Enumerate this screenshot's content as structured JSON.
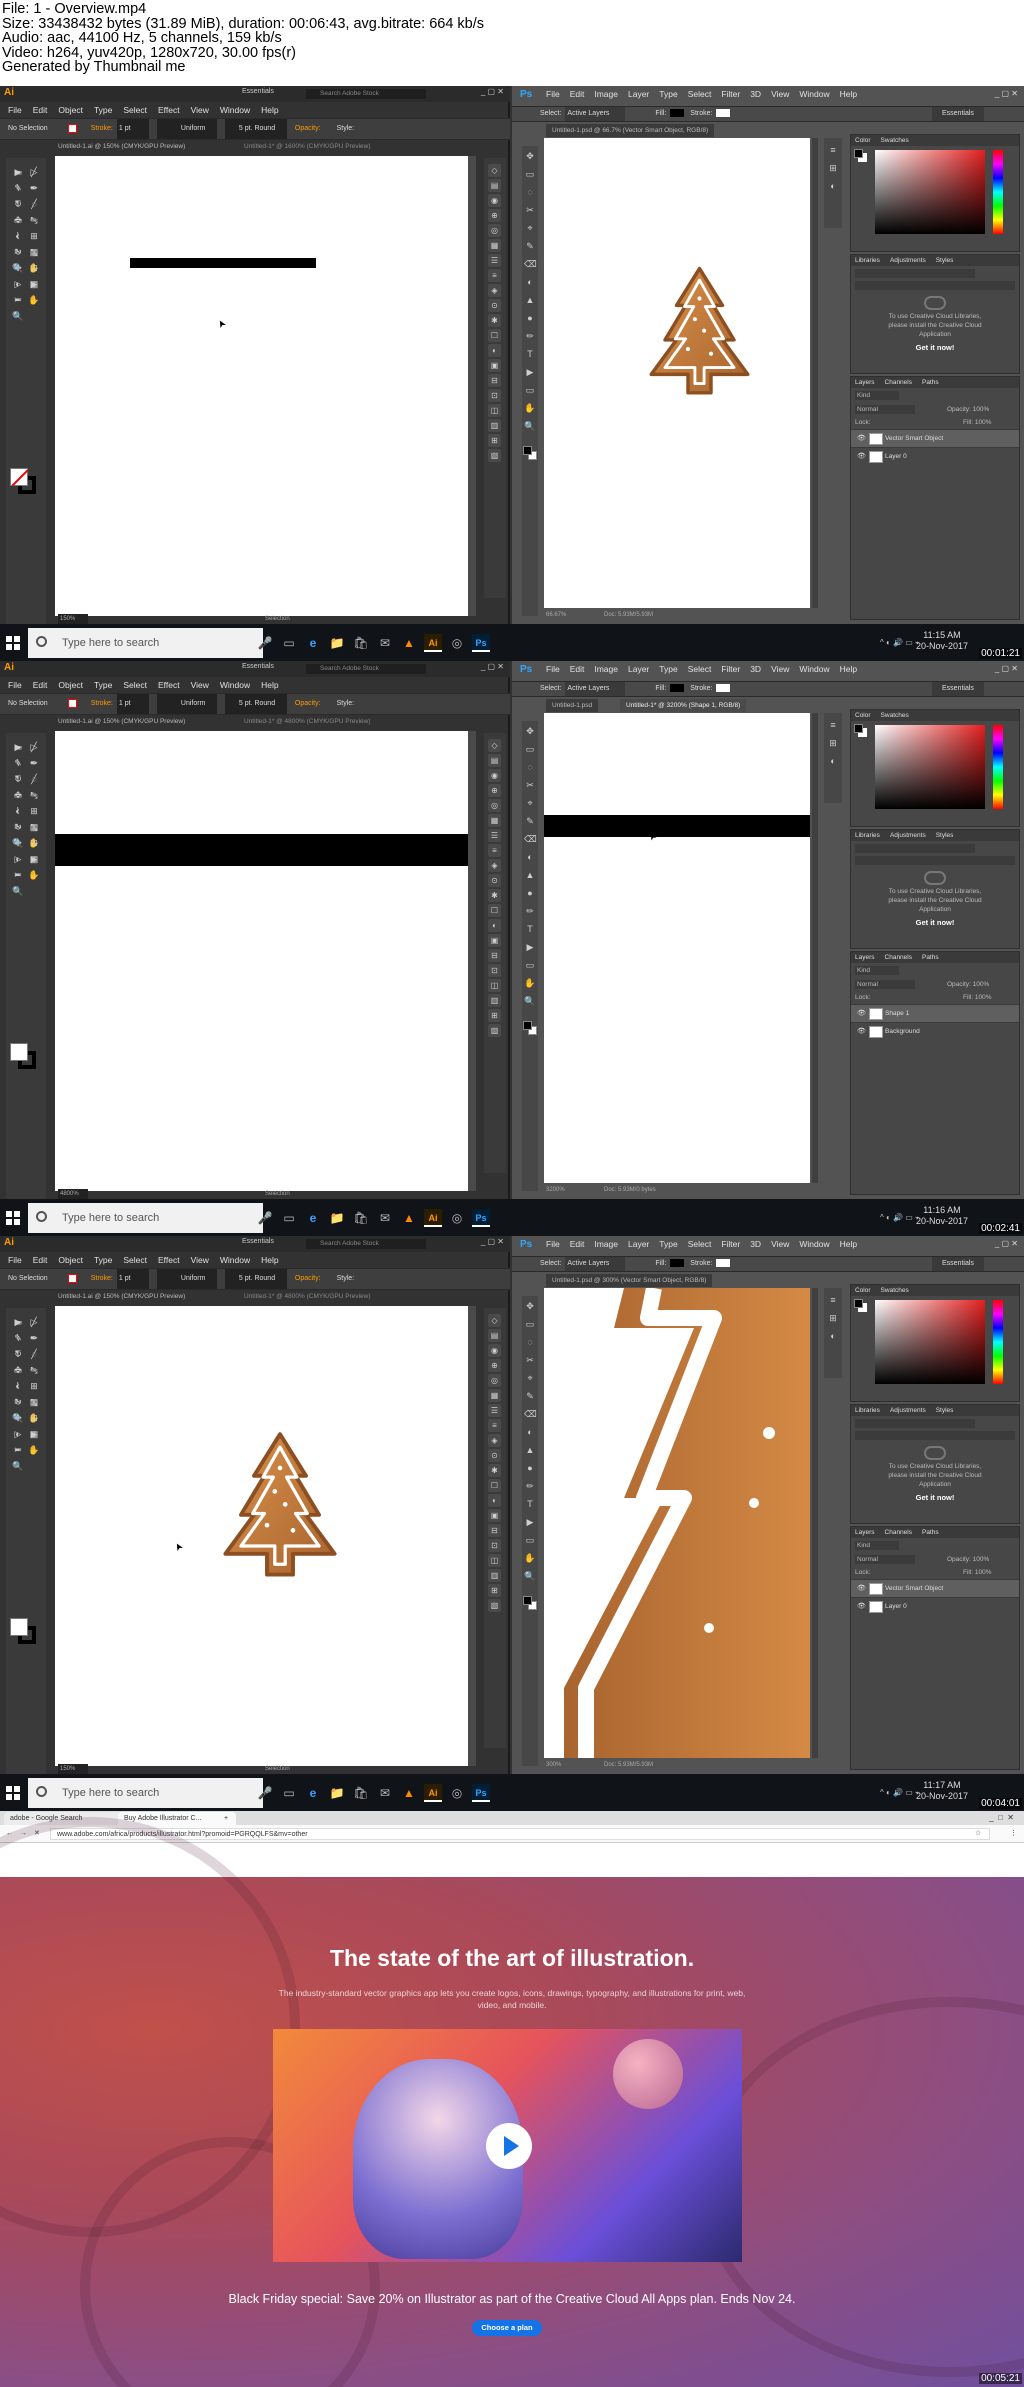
{
  "header": {
    "lines": [
      "File: 1 - Overview.mp4",
      "Size: 33438432 bytes (31.89 MiB), duration: 00:06:43, avg.bitrate: 664 kb/s",
      "Audio: aac, 44100 Hz, 5 channels, 159 kb/s",
      "Video: h264, yuv420p, 1280x720, 30.00 fps(r)",
      "Generated by Thumbnail me"
    ]
  },
  "illustrator": {
    "logo": "Ai",
    "workspace": "Essentials",
    "search_placeholder": "Search Adobe Stock",
    "menu": [
      "File",
      "Edit",
      "Object",
      "Type",
      "Select",
      "Effect",
      "View",
      "Window",
      "Help"
    ],
    "options": {
      "selection": "No Selection",
      "stroke_label": "Stroke:",
      "stroke_weight": "1 pt",
      "uniform": "Uniform",
      "brush": "5 pt. Round",
      "opacity_label": "Opacity:",
      "style_label": "Style:"
    },
    "status_label": "Selection"
  },
  "photoshop": {
    "logo": "Ps",
    "menu": [
      "File",
      "Edit",
      "Image",
      "Layer",
      "Type",
      "Select",
      "Filter",
      "3D",
      "View",
      "Window",
      "Help"
    ],
    "options": {
      "select_label": "Select:",
      "select_value": "Active Layers",
      "fill_label": "Fill:",
      "stroke_label": "Stroke:"
    },
    "workspace": "Essentials",
    "panels": {
      "color_tabs": [
        "Color",
        "Swatches"
      ],
      "libraries_tabs": [
        "Libraries",
        "Adjustments",
        "Styles"
      ],
      "libraries_message": "To use Creative Cloud Libraries, please install the Creative Cloud Application",
      "get_it_now": "Get it now!",
      "layers_tabs": [
        "Layers",
        "Channels",
        "Paths"
      ],
      "kind": "Kind",
      "blend": "Normal",
      "opacity": "Opacity: 100%",
      "lock": "Lock:",
      "fill": "Fill: 100%"
    }
  },
  "frames": [
    {
      "ai_tab": "Untitled-1.ai @ 150% (CMYK/GPU Preview)",
      "ai_tab2": "Untitled-1* @ 1600% (CMYK/GPU Preview)",
      "ai_zoom": "150%",
      "ps_tab": "Untitled-1.psd @ 66.7% (Vector Smart Object, RGB/8)",
      "ps_tab2": "",
      "ps_zoom": "66.67%",
      "ps_doc": "Doc: 5.93M/5.93M",
      "layers": [
        {
          "name": "Vector Smart Object",
          "selected": true
        },
        {
          "name": "Layer 0",
          "selected": false
        }
      ],
      "time": "11:15 AM",
      "date": "20-Nov-2017",
      "stamp": "00:01:21"
    },
    {
      "ai_tab": "Untitled-1.ai @ 150% (CMYK/GPU Preview)",
      "ai_tab2": "Untitled-1* @ 4800% (CMYK/GPU Preview)",
      "ai_zoom": "4800%",
      "ps_tab": "Untitled-1.psd",
      "ps_tab2": "Untitled-1* @ 3200% (Shape 1, RGB/8)",
      "ps_zoom": "3200%",
      "ps_doc": "Doc: 5.93M/0 bytes",
      "layers": [
        {
          "name": "Shape 1",
          "selected": true
        },
        {
          "name": "Background",
          "selected": false
        }
      ],
      "time": "11:16 AM",
      "date": "20-Nov-2017",
      "stamp": "00:02:41"
    },
    {
      "ai_tab": "Untitled-1.ai @ 150% (CMYK/GPU Preview)",
      "ai_tab2": "Untitled-1* @ 4800% (CMYK/GPU Preview)",
      "ai_zoom": "150%",
      "ps_tab": "Untitled-1.psd @ 300% (Vector Smart Object, RGB/8)",
      "ps_tab2": "",
      "ps_zoom": "300%",
      "ps_doc": "Doc: 5.93M/5.93M",
      "layers": [
        {
          "name": "Vector Smart Object",
          "selected": true
        },
        {
          "name": "Layer 0",
          "selected": false
        }
      ],
      "time": "11:17 AM",
      "date": "20-Nov-2017",
      "stamp": "00:04:01"
    }
  ],
  "taskbar": {
    "search_placeholder": "Type here to search"
  },
  "browser": {
    "tabs": [
      "adobe - Google Search",
      "Buy Adobe Illustrator C..."
    ],
    "url": "www.adobe.com/africa/products/illustrator.html?promoid=PGRQQLFS&mv=other",
    "headline": "The state of the art of illustration.",
    "subhead": "The industry-standard vector graphics app lets you create logos, icons, drawings, typography, and illustrations for print, web, video, and mobile.",
    "promo": "Black Friday special: Save 20% on Illustrator as part of the Creative Cloud All Apps plan. Ends Nov 24.",
    "cta": "Choose a plan",
    "stamp": "00:05:21"
  },
  "colors": {
    "accent_ai": "#ff9a00",
    "accent_ps": "#31a8ff",
    "cta": "#1473e6",
    "cookie": "#c07a3d"
  }
}
